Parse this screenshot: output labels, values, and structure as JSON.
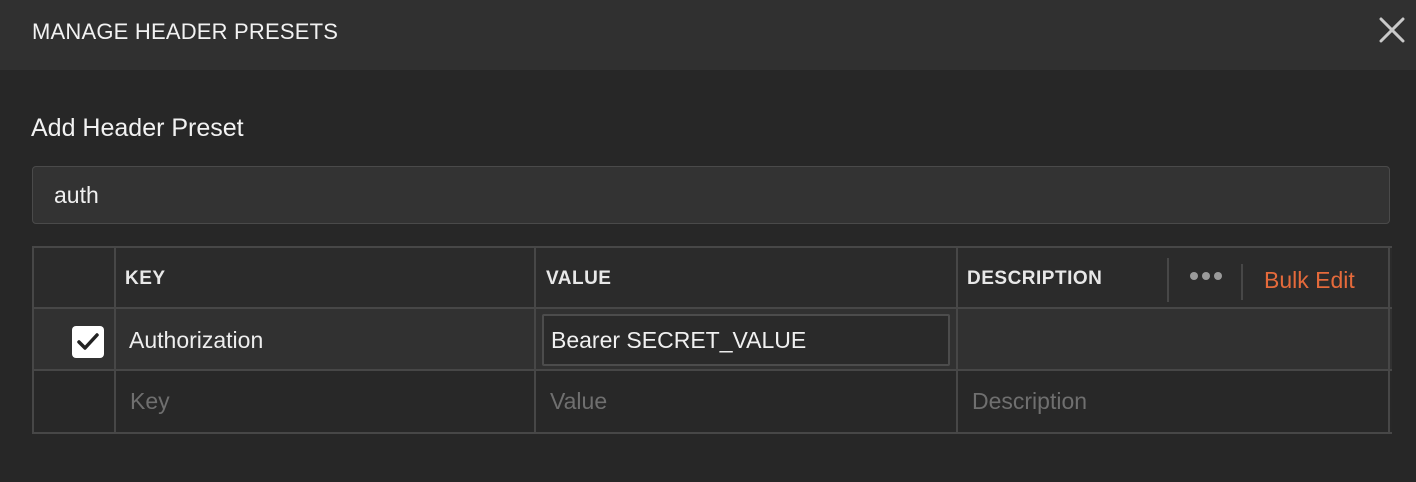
{
  "modal": {
    "title": "MANAGE HEADER PRESETS"
  },
  "form": {
    "section_title": "Add Header Preset",
    "preset_name_value": "auth"
  },
  "table": {
    "columns": {
      "key": "KEY",
      "value": "VALUE",
      "description": "DESCRIPTION"
    },
    "bulk_edit_label": "Bulk Edit",
    "rows": [
      {
        "checked": true,
        "key": "Authorization",
        "value": "Bearer SECRET_VALUE",
        "description": ""
      }
    ],
    "new_row": {
      "key_placeholder": "Key",
      "value_placeholder": "Value",
      "description_placeholder": "Description"
    }
  },
  "colors": {
    "accent": "#e56a3b",
    "background": "#272727",
    "header_background": "#303030",
    "border": "#474747"
  },
  "icons": {
    "close": "close-icon",
    "more": "more-horizontal-icon",
    "check": "check-icon"
  }
}
